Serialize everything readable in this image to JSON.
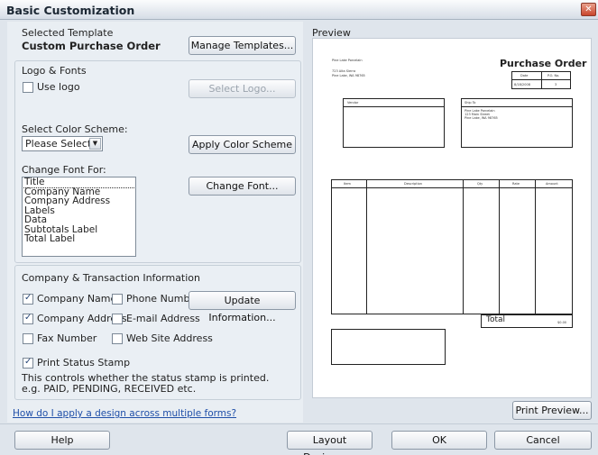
{
  "window": {
    "title": "Basic Customization",
    "close_glyph": "✕"
  },
  "selected_template": {
    "label": "Selected Template",
    "name": "Custom Purchase Order",
    "manage_button": "Manage Templates..."
  },
  "logo_fonts": {
    "header": "Logo & Fonts",
    "use_logo": {
      "label": "Use logo",
      "checked": false
    },
    "select_logo_button": "Select Logo...",
    "color_scheme_label": "Select Color Scheme:",
    "color_scheme_value": "Please Select...",
    "apply_color_button": "Apply Color Scheme",
    "change_font_for_label": "Change Font For:",
    "font_items": [
      "Title",
      "Company Name",
      "Company Address",
      "Labels",
      "Data",
      "Subtotals Label",
      "Total Label"
    ],
    "selected_font_item": "Title",
    "change_font_button": "Change Font..."
  },
  "company_info": {
    "header": "Company & Transaction Information",
    "company_name": {
      "label": "Company Name",
      "checked": true
    },
    "phone_number": {
      "label": "Phone Number",
      "checked": false
    },
    "company_address": {
      "label": "Company Address",
      "checked": true
    },
    "email_address": {
      "label": "E-mail Address",
      "checked": false
    },
    "fax_number": {
      "label": "Fax Number",
      "checked": false
    },
    "web_site": {
      "label": "Web Site Address",
      "checked": false
    },
    "update_button": "Update Information...",
    "print_status": {
      "label": "Print Status Stamp",
      "checked": true
    },
    "status_note_1": "This controls whether the status stamp is printed.",
    "status_note_2": "e.g. PAID, PENDING, RECEIVED etc."
  },
  "help_link": "How do I apply a design across multiple forms?",
  "preview": {
    "label": "Preview",
    "doc_title": "Purchase Order",
    "company_line1": "Pine Lake Porcelain",
    "company_line2": "723 Alta Sierra",
    "company_line3": "Pine Lake, WA 98765",
    "date_label": "Date",
    "po_label": "P.O. No.",
    "date_value": "8/18/2008",
    "po_value": "3",
    "vendor_label": "Vendor",
    "ship_to_label": "Ship To",
    "ship_to_line1": "Pine Lake Porcelain",
    "ship_to_line2": "123 Main Street",
    "ship_to_line3": "Pine Lake, WA 98765",
    "columns": [
      "Item",
      "Description",
      "Qty",
      "Rate",
      "Amount"
    ],
    "total_label": "Total",
    "total_value": "$0.00",
    "print_preview_button": "Print Preview..."
  },
  "footer": {
    "help": "Help",
    "layout_designer": "Layout Designer...",
    "ok": "OK",
    "cancel": "Cancel"
  }
}
